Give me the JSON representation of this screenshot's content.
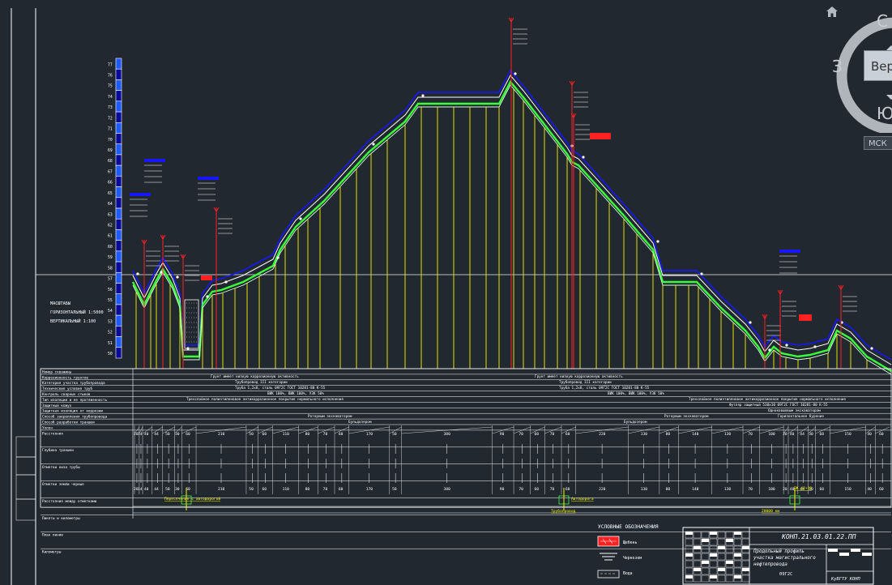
{
  "viewport": {
    "home_icon": "home-icon",
    "cube_letters": {
      "north": "С",
      "west": "З",
      "south": "Ю"
    },
    "cube_face": "Верх",
    "ucs_label": "МСК"
  },
  "scale_block": {
    "label_lines": [
      "МАСШТАБЫ",
      "ГОРИЗОНТАЛЬНЫЙ 1:5000",
      "ВЕРТИКАЛЬНЫЙ 1:100"
    ]
  },
  "profile": {
    "ticks": [
      77,
      76,
      75,
      74,
      73,
      72,
      71,
      70,
      69,
      68,
      67,
      66,
      65,
      64,
      63,
      62,
      61,
      60,
      59,
      58,
      57,
      56,
      55,
      54,
      53,
      52,
      51,
      50
    ],
    "row_labels": [
      "Номер скважины",
      "Коррозионность грунтов",
      "Категория участка трубопровода",
      "Технические условия труб",
      "Контроль сварных стыков",
      "Тип изоляции и ее протяженность",
      "Защитный кожух",
      "Защитная изоляция от коррозии",
      "Способ закрепления трубопровода",
      "Способ разработки траншеи",
      "Уклон",
      "Расстояния",
      "Глубина траншеи",
      "Отметки низа трубы",
      "Отметки земли черные",
      "Расстояния между отметками",
      "Пикеты и километры",
      "План линии",
      "Километры"
    ],
    "row_texts": [
      "Грунт имеет низкую коррозионную активность",
      "Грунт имеет низкую коррозионную активность",
      "Трубопровод III категории",
      "Трубопровод III категории",
      "Труба 1,2х8, сталь 09Г2С ГОСТ 10281-80 К-55",
      "Труба 1,2х8, сталь 09Г2С ГОСТ 10281-80 К-55",
      "ВИК 100%, ВИК 100%, УЗК 50%",
      "ВИК 100%, ВИК 100%, УЗК 50%",
      "Трехслойное полиэтиленовое антикоррозионное покрытие нормального исполнения",
      "Трехслойное полиэтиленовое антикоррозионное покрытие нормального исполнения",
      "Футляр защитный 530х10 09Г2С ГОСТ 10281-80 К-55",
      "Роторным экскаватором",
      "Бульдозером",
      "Роторным экскаватором",
      "Бульдозером",
      "Одноковшовым экскаватором",
      "Горизонтальное бурение"
    ],
    "distances": [
      "20",
      "14",
      "40",
      "44",
      "50",
      "30",
      "60",
      "210",
      "50",
      "60",
      "110",
      "80",
      "70",
      "60",
      "170",
      "50",
      "380",
      "90",
      "70",
      "60",
      "70",
      "60",
      "220",
      "130",
      "80",
      "140",
      "130",
      "70",
      "100",
      "20",
      "40",
      "44",
      "30",
      "60",
      "150",
      "40",
      "60"
    ],
    "station_labels": [
      "Пересечение с автодорогой",
      "ПК 42+19",
      "Трубопровод",
      "Автодорога",
      "20000 км"
    ]
  },
  "legend": {
    "title": "УСЛОВНЫЕ ОБОЗНАЧЕНИЯ",
    "items": [
      "Щебень",
      "Чернозем",
      "Вода"
    ]
  },
  "title_block": {
    "code": "КОНП.21.03.01.22.ПП",
    "description_lines": [
      "Продольный профиль",
      "участка магистрального",
      "нефтепровода"
    ],
    "sheet": "09Г2С",
    "org": "КуБГТУ КОНП"
  }
}
